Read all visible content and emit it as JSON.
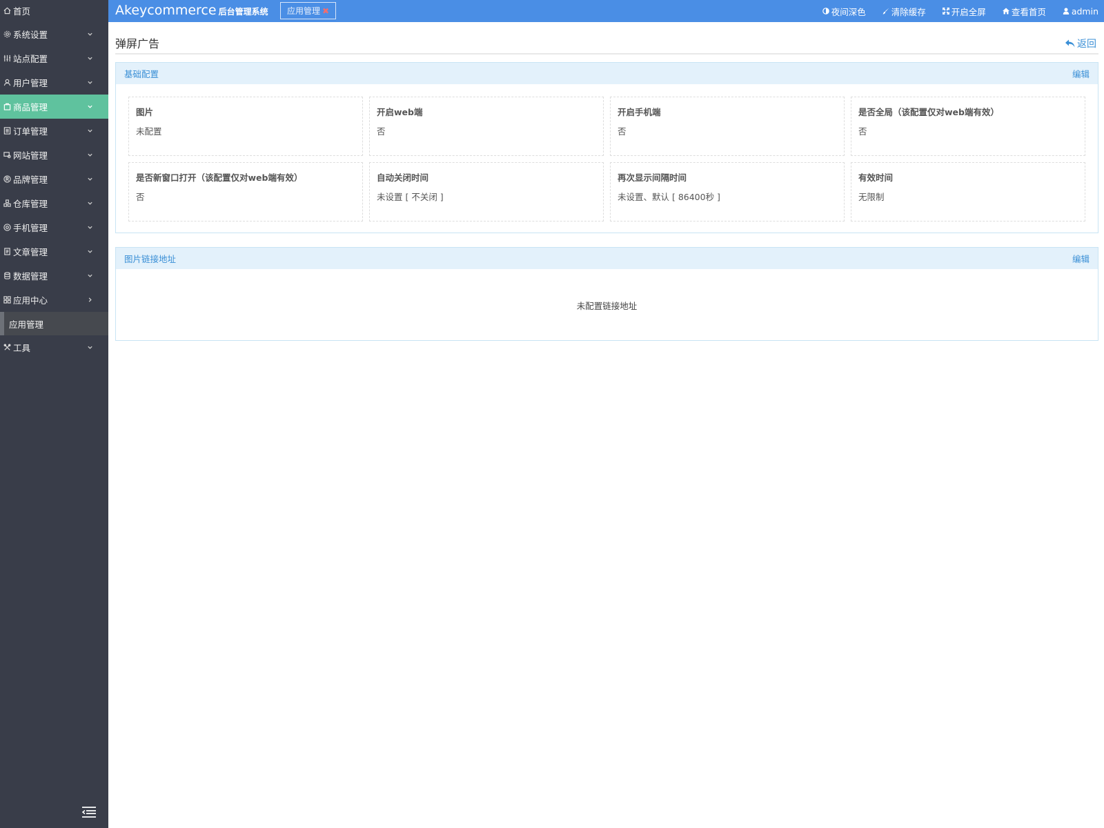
{
  "sidebar": {
    "home": "首页",
    "items": [
      {
        "label": "系统设置",
        "icon": "gear-icon"
      },
      {
        "label": "站点配置",
        "icon": "sliders-icon"
      },
      {
        "label": "用户管理",
        "icon": "user-icon"
      },
      {
        "label": "商品管理",
        "icon": "goods-icon"
      },
      {
        "label": "订单管理",
        "icon": "order-icon"
      },
      {
        "label": "网站管理",
        "icon": "site-icon"
      },
      {
        "label": "品牌管理",
        "icon": "brand-icon"
      },
      {
        "label": "仓库管理",
        "icon": "warehouse-icon"
      },
      {
        "label": "手机管理",
        "icon": "mobile-icon"
      },
      {
        "label": "文章管理",
        "icon": "article-icon"
      },
      {
        "label": "数据管理",
        "icon": "database-icon"
      },
      {
        "label": "应用中心",
        "icon": "apps-icon"
      }
    ],
    "sub_item": "应用管理",
    "tools": "工具",
    "active_color": "#5fc29e"
  },
  "header": {
    "brand": "Akeycommerce",
    "brand_sub": "后台管理系统",
    "tab_label": "应用管理",
    "actions": [
      "夜间深色",
      "清除缓存",
      "开启全屏",
      "查看首页",
      "admin"
    ],
    "bar_color": "#4a8ee5"
  },
  "main": {
    "title": "弹屏广告",
    "back": "返回",
    "panel1": {
      "title": "基础配置",
      "edit": "编辑",
      "fields": [
        {
          "label": "图片",
          "value": "未配置"
        },
        {
          "label": "开启web端",
          "value": "否"
        },
        {
          "label": "开启手机端",
          "value": "否"
        },
        {
          "label": "是否全局（该配置仅对web端有效）",
          "value": "否"
        },
        {
          "label": "是否新窗口打开（该配置仅对web端有效）",
          "value": "否"
        },
        {
          "label": "自动关闭时间",
          "value": "未设置 [ 不关闭 ]"
        },
        {
          "label": "再次显示间隔时间",
          "value": "未设置、默认 [ 86400秒 ]"
        },
        {
          "label": "有效时间",
          "value": "无限制"
        }
      ]
    },
    "panel2": {
      "title": "图片链接地址",
      "edit": "编辑",
      "empty": "未配置链接地址"
    }
  }
}
